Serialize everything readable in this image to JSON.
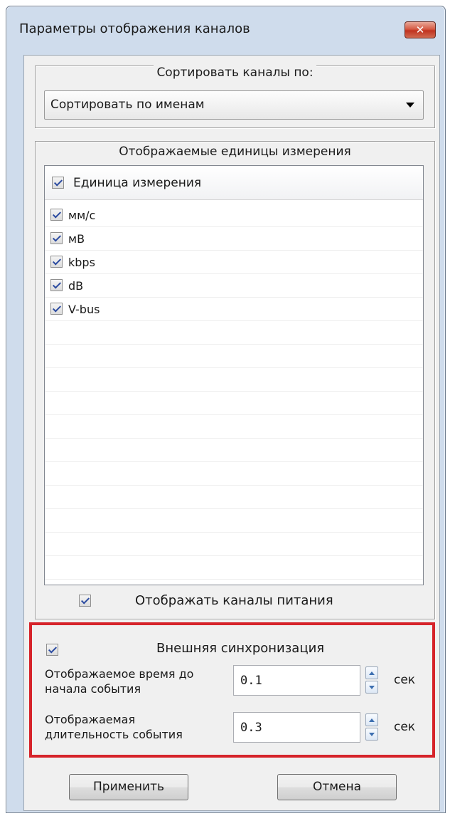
{
  "window": {
    "title": "Параметры отображения каналов",
    "close_symbol": "✕"
  },
  "sort_group": {
    "title": "Сортировать каналы по:",
    "selected": "Сортировать по именам"
  },
  "units_group": {
    "title": "Отображаемые единицы измерения",
    "header": {
      "label": "Единица измерения",
      "checked": true
    },
    "items": [
      {
        "label": "мм/с",
        "checked": true
      },
      {
        "label": "мВ",
        "checked": true
      },
      {
        "label": "kbps",
        "checked": true
      },
      {
        "label": "dB",
        "checked": true
      },
      {
        "label": "V-bus",
        "checked": true
      }
    ],
    "power_channels": {
      "label": "Отображать каналы питания",
      "checked": true
    }
  },
  "sync_group": {
    "title": "Внешняя синхронизация",
    "checked": true,
    "pre_event": {
      "label_line1": "Отображаемое время до",
      "label_line2": "начала события",
      "value": "0.1",
      "unit": "сек"
    },
    "duration": {
      "label_line1": "Отображаемая",
      "label_line2": "длительность события",
      "value": "0.3",
      "unit": "сек"
    }
  },
  "buttons": {
    "apply": "Применить",
    "cancel": "Отмена"
  },
  "colors": {
    "highlight_border": "#d6232a",
    "check_mark": "#2a4aa0"
  }
}
